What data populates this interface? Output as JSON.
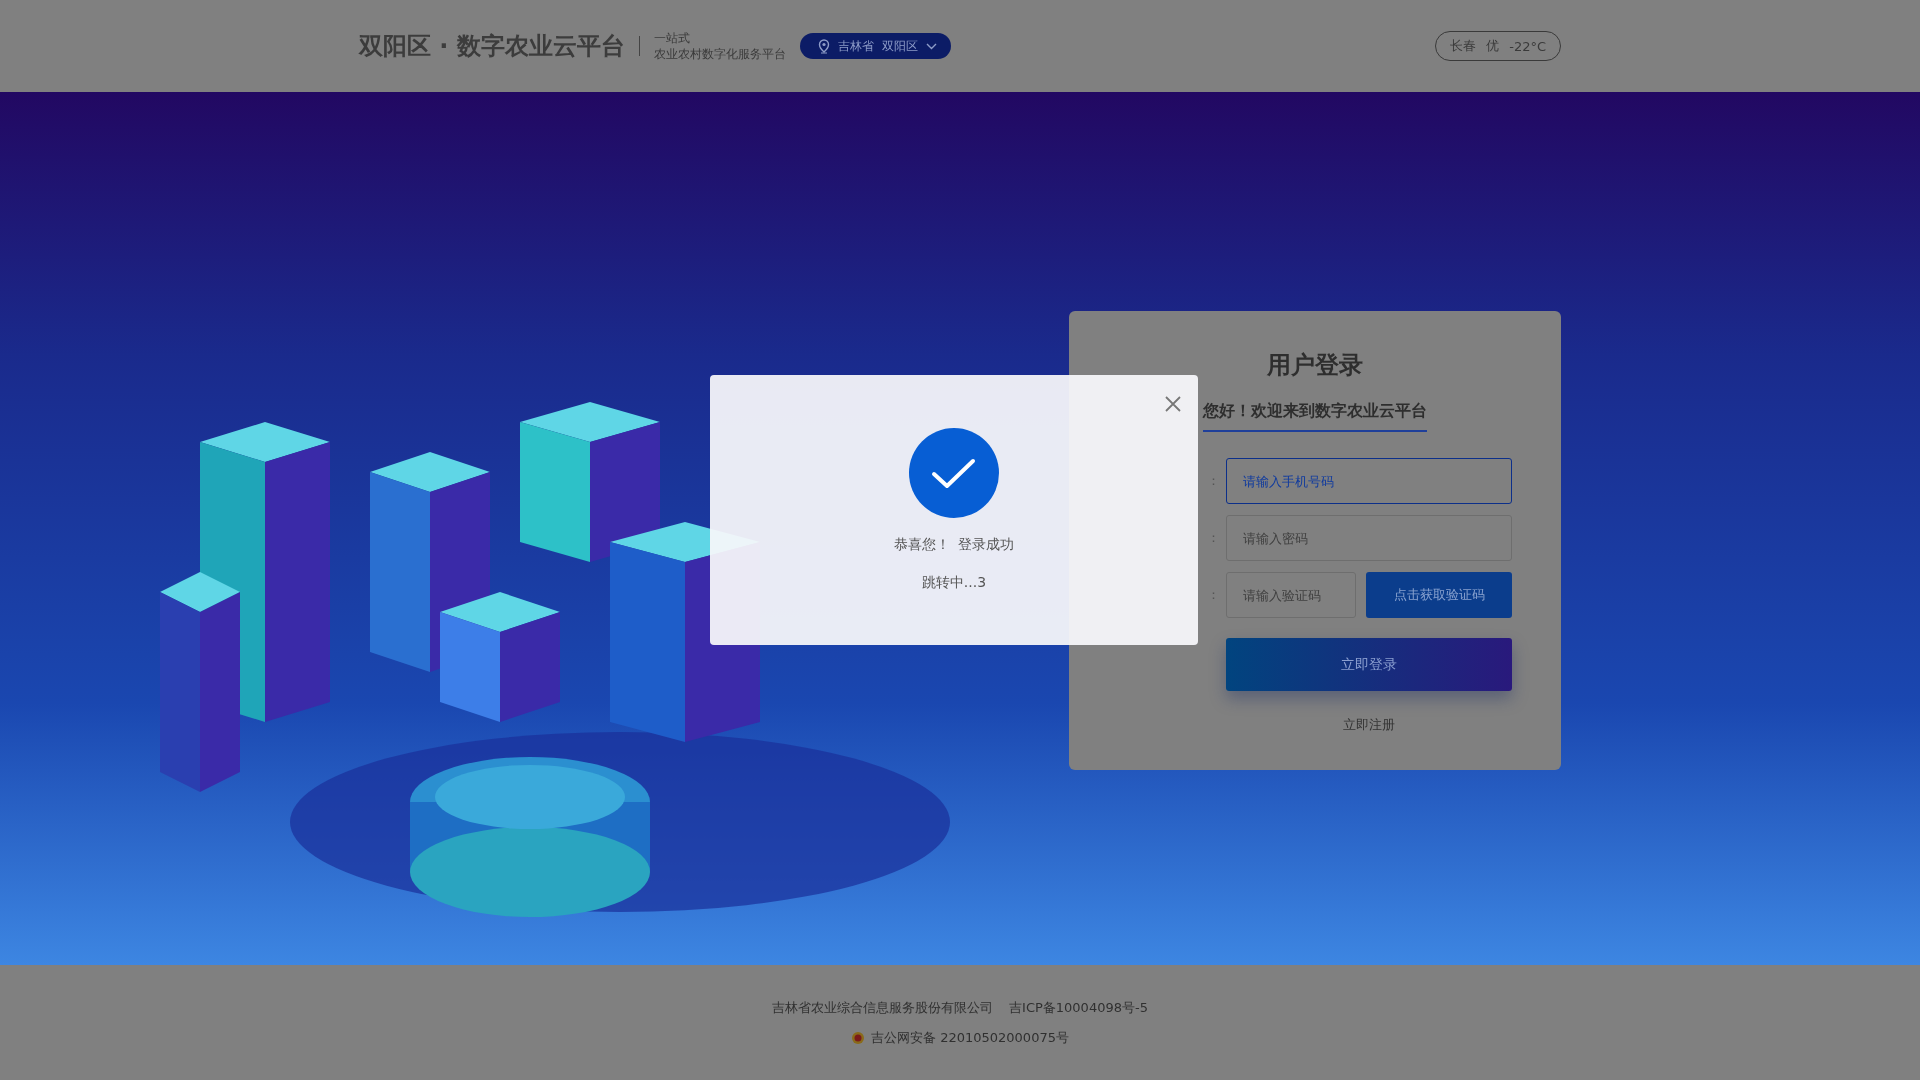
{
  "header": {
    "title": "双阳区 · 数字农业云平台",
    "tagline": [
      "一站式",
      "农业农村数字化服务平台"
    ],
    "location": {
      "province": "吉林省",
      "district": "双阳区"
    },
    "weather": {
      "city": "长春",
      "quality": "优",
      "temperature": "-22°C"
    }
  },
  "login": {
    "title": "用户登录",
    "subtitle": "您好！欢迎来到数字农业云平台",
    "fields": [
      {
        "kind": "input",
        "label": "：",
        "placeholder": "请输入手机号码",
        "focused": true
      },
      {
        "kind": "input",
        "label": "：",
        "placeholder": "请输入密码",
        "focused": false
      },
      {
        "kind": "code",
        "label": "：",
        "placeholder": "请输入验证码",
        "focused": false,
        "button": "点击获取验证码"
      }
    ],
    "submit": "立即登录",
    "register": "立即注册"
  },
  "dialog": {
    "message": [
      "恭喜您！",
      "登录成功"
    ],
    "countdown": "跳转中...3"
  },
  "footer": {
    "company": "吉林省农业综合信息服务股份有限公司",
    "icp": "吉ICP备10004098号-5",
    "police": "吉公网安备 22010502000075号"
  }
}
